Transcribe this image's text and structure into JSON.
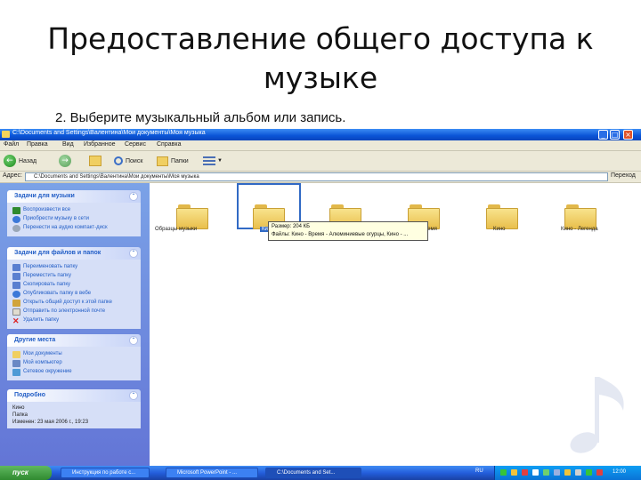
{
  "slide": {
    "title": "Предоставление общего доступа к музыке",
    "subtitle": "2. Выберите музыкальный альбом или запись."
  },
  "window": {
    "title": "C:\\Documents and Settings\\Валентина\\Мои документы\\Моя музыка",
    "controls": [
      "_",
      "□",
      "×"
    ],
    "menu": [
      "Файл",
      "Правка",
      "Вид",
      "Избранное",
      "Сервис",
      "Справка"
    ],
    "toolbar": {
      "back": "Назад",
      "search": "Поиск",
      "folders": "Папки"
    },
    "address": {
      "label": "Адрес:",
      "value": "C:\\Documents and Settings\\Валентина\\Мои документы\\Моя музыка",
      "go": "Переход"
    }
  },
  "left_pane": {
    "music_tasks": {
      "header": "Задачи для музыки",
      "items": [
        "Воспроизвести все",
        "Приобрести музыку в сети",
        "Перенести на аудио компакт-диск"
      ]
    },
    "file_tasks": {
      "header": "Задачи для файлов и папок",
      "items": [
        "Переименовать папку",
        "Переместить папку",
        "Скопировать папку",
        "Опубликовать папку в вебе",
        "Открыть общий доступ к этой папке",
        "Отправить по электронной почте",
        "Удалить папку"
      ]
    },
    "other_places": {
      "header": "Другие места",
      "items": [
        "Мои документы",
        "Мой компьютер",
        "Сетевое окружение"
      ]
    },
    "details": {
      "header": "Подробно",
      "lines": [
        "Кино",
        "Папка",
        "Изменен: 23 мая 2006 г., 19:23"
      ]
    }
  },
  "folders": [
    {
      "label": "Образцы музыки"
    },
    {
      "label": "Кино"
    },
    {
      "label": ""
    },
    {
      "label": "Кино - Время"
    },
    {
      "label": "Кино"
    },
    {
      "label": "Кино - Легенда"
    }
  ],
  "tooltip": {
    "line1": "Размер: 204 КБ",
    "line2": "Файлы: Кино - Время - Алюминиевые огурцы, Кино - ..."
  },
  "taskbar": {
    "start": "пуск",
    "items": [
      "Инструкция по работе с...",
      "Microsoft PowerPoint - ...",
      "C:\\Documents and Set..."
    ],
    "tray_label": "RU",
    "clock": "12:00"
  },
  "colors": {
    "title_bar": "#0a54d6",
    "left_pane": "#6d8ee0",
    "start_button": "#2f8a2f",
    "link": "#215dc6"
  }
}
